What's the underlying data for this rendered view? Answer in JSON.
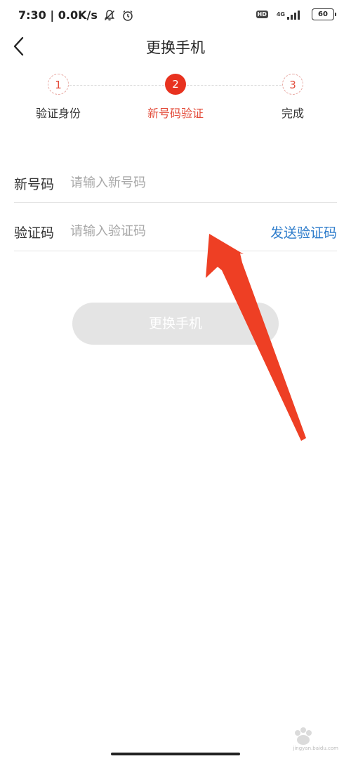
{
  "status_bar": {
    "time_speed": "7:30 | 0.0K/s",
    "hd_badge": "HD",
    "network": "4G",
    "battery": "60"
  },
  "header": {
    "title": "更换手机"
  },
  "steps": [
    {
      "number": "1",
      "label": "验证身份",
      "state": "inactive"
    },
    {
      "number": "2",
      "label": "新号码验证",
      "state": "active"
    },
    {
      "number": "3",
      "label": "完成",
      "state": "inactive"
    }
  ],
  "form": {
    "phone_label": "新号码",
    "phone_placeholder": "请输入新号码",
    "code_label": "验证码",
    "code_placeholder": "请输入验证码",
    "send_code": "发送验证码"
  },
  "submit_label": "更换手机",
  "watermark": {
    "brand": "Baidu 经验",
    "url": "jingyan.baidu.com"
  },
  "colors": {
    "accent": "#e8321f",
    "link": "#2d7ccb",
    "disabled_button": "#e4e4e4"
  }
}
